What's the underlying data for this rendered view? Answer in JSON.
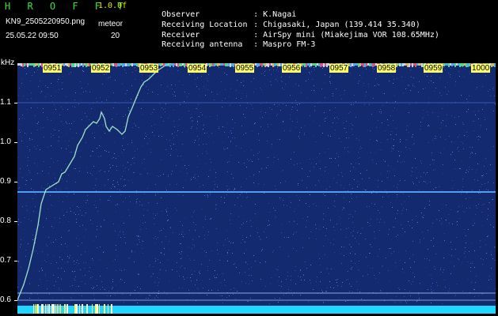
{
  "header": {
    "app_title": "H R O F F T",
    "version": "1.0.0f",
    "filename": "KN9_2505220950.png",
    "mode": "meteor",
    "datetime": "25.05.22 09:50",
    "scale": "20",
    "meta": [
      {
        "key": "Observer",
        "value": ": K.Nagai"
      },
      {
        "key": "Receiving Location",
        "value": ": Chigasaki, Japan (139.414 35.340)"
      },
      {
        "key": "Receiver",
        "value": ": AirSpy mini (Miakejima VOR 108.65MHz)"
      },
      {
        "key": "Receiving antenna",
        "value": ": Maspro FM-3"
      }
    ]
  },
  "spectrogram": {
    "unit_label": "kHz",
    "y_labels": [
      "1.1",
      "1.0",
      "0.9",
      "0.8",
      "0.7",
      "0.6"
    ],
    "time_labels": [
      "0951",
      "0952",
      "0953",
      "0954",
      "0955",
      "0956",
      "0957",
      "0958",
      "0959",
      "1000"
    ],
    "colors": {
      "background": "#142a6e",
      "trace": "#9fe3c8",
      "carrier": "#5aa9ff",
      "bottom_band": "#20d7ff"
    }
  }
}
